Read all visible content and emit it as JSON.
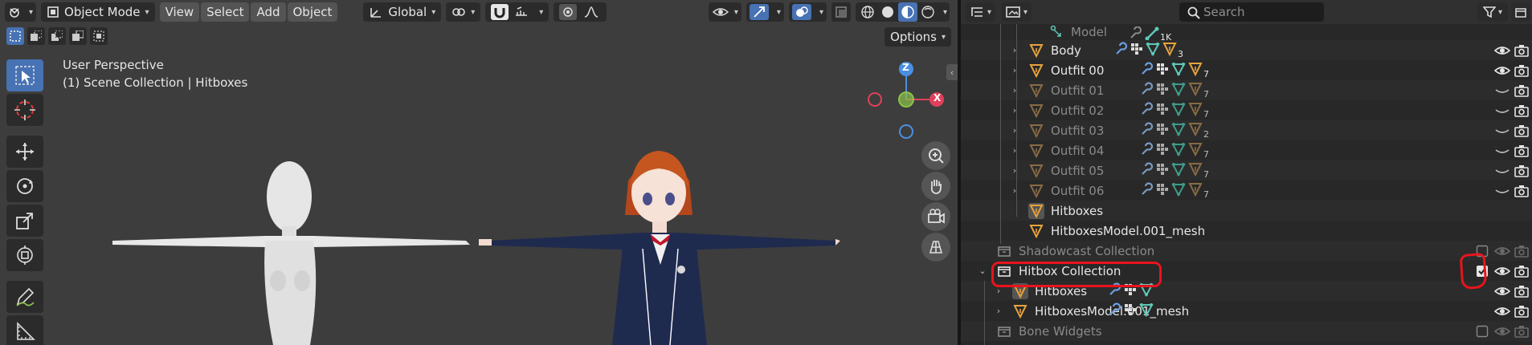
{
  "viewport": {
    "mode": "Object Mode",
    "menus": [
      "View",
      "Select",
      "Add",
      "Object"
    ],
    "transform_orientation": "Global",
    "options_label": "Options",
    "perspective_label": "User Perspective",
    "collection_label": "(1) Scene Collection | Hitboxes",
    "gizmo": {
      "z": "Z",
      "x": "X"
    },
    "tools": [
      "select-box",
      "cursor",
      "move",
      "rotate",
      "scale",
      "transform",
      "annotate",
      "measure"
    ]
  },
  "outliner": {
    "search_placeholder": "Search",
    "rows": [
      {
        "name": "Model",
        "sub": "1K",
        "dim": true,
        "indent": 1
      },
      {
        "name": "Body",
        "sub": "3",
        "indent": 2
      },
      {
        "name": "Outfit 00",
        "sub": "7",
        "indent": 2
      },
      {
        "name": "Outfit 01",
        "sub": "7",
        "dim": true,
        "indent": 2
      },
      {
        "name": "Outfit 02",
        "sub": "7",
        "dim": true,
        "indent": 2
      },
      {
        "name": "Outfit 03",
        "sub": "2",
        "dim": true,
        "indent": 2
      },
      {
        "name": "Outfit 04",
        "sub": "7",
        "dim": true,
        "indent": 2
      },
      {
        "name": "Outfit 05",
        "sub": "7",
        "dim": true,
        "indent": 2
      },
      {
        "name": "Outfit 06",
        "sub": "7",
        "dim": true,
        "indent": 2
      },
      {
        "name": "Hitboxes",
        "indent": 2
      },
      {
        "name": "HitboxesModel.001_mesh",
        "indent": 2
      },
      {
        "name": "Shadowcast Collection",
        "dim": true,
        "indent": 1
      },
      {
        "name": "Hitbox Collection",
        "indent": 0
      },
      {
        "name": "Hitboxes",
        "indent": 1
      },
      {
        "name": "HitboxesModel.001_mesh",
        "indent": 1
      },
      {
        "name": "Bone Widgets",
        "dim": true,
        "indent": 1
      }
    ]
  },
  "colors": {
    "accent": "#4772b3",
    "mesh_orange": "#e8a33d",
    "annotation_red": "#e8141c",
    "axis_x": "#e0405a",
    "axis_y": "#8bc34a",
    "axis_z": "#4a90e2"
  }
}
